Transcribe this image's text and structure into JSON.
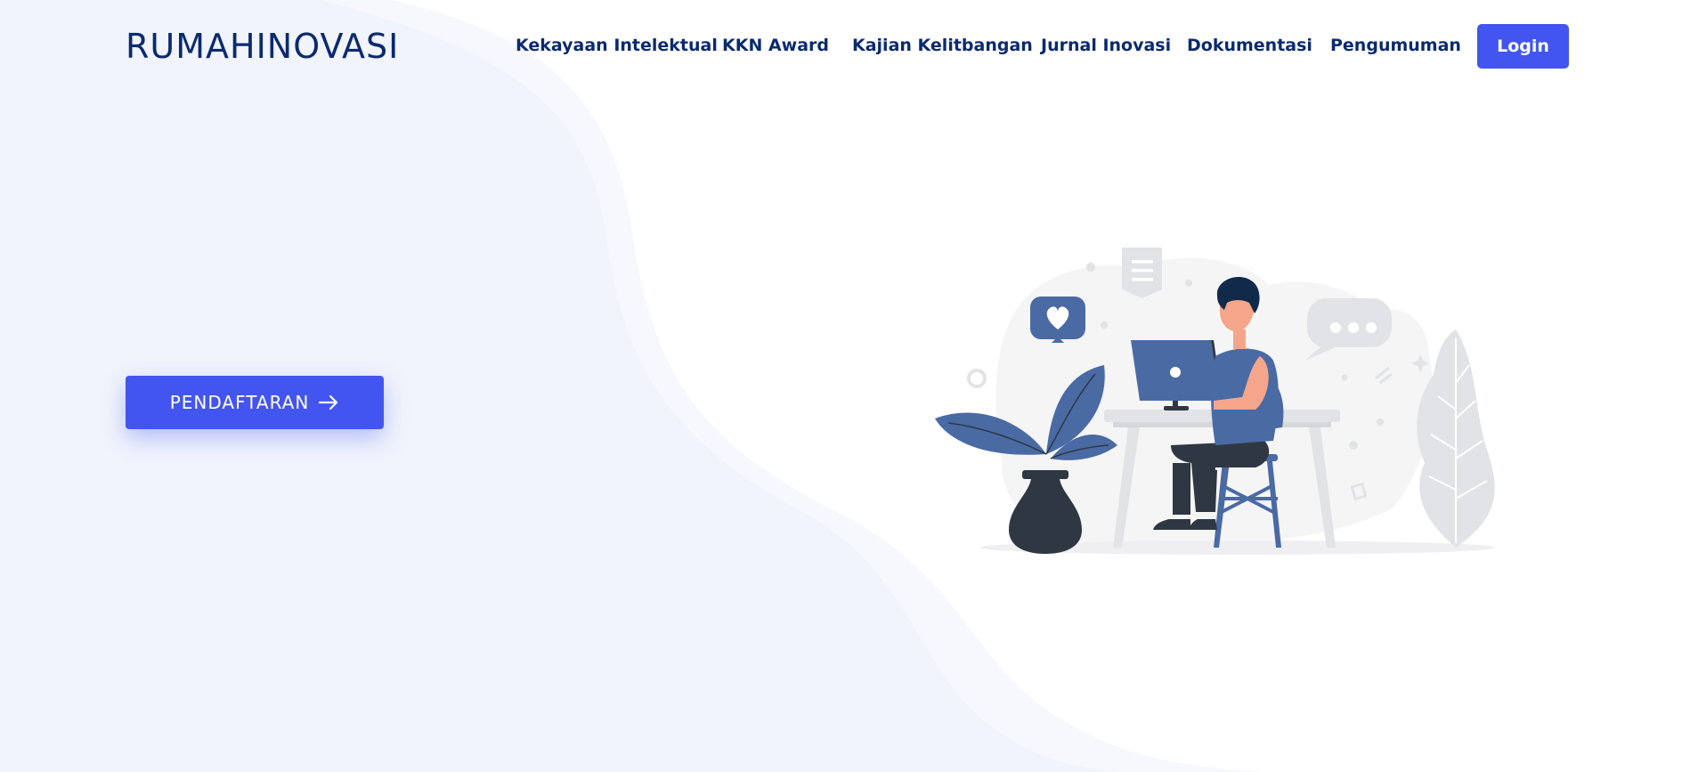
{
  "header": {
    "brand": "RUMAHINOVASI",
    "nav": [
      {
        "label": "Kekayaan Intelektual"
      },
      {
        "label": "KKN Award"
      },
      {
        "label": "Kajian Kelitbangan"
      },
      {
        "label": "Jurnal Inovasi"
      },
      {
        "label": "Dokumentasi"
      },
      {
        "label": "Pengumuman"
      }
    ],
    "login_label": "Login"
  },
  "hero": {
    "cta_label": "PENDAFTARAN",
    "cta_icon": "arrow-right-icon",
    "illustration": "person-working-at-laptop-illustration"
  },
  "colors": {
    "brand_text": "#0b2a6f",
    "accent": "#4355f0",
    "background_wave": "#f1f4fc",
    "illustration_blue": "#4a6aa4",
    "illustration_dark": "#2f3743"
  }
}
